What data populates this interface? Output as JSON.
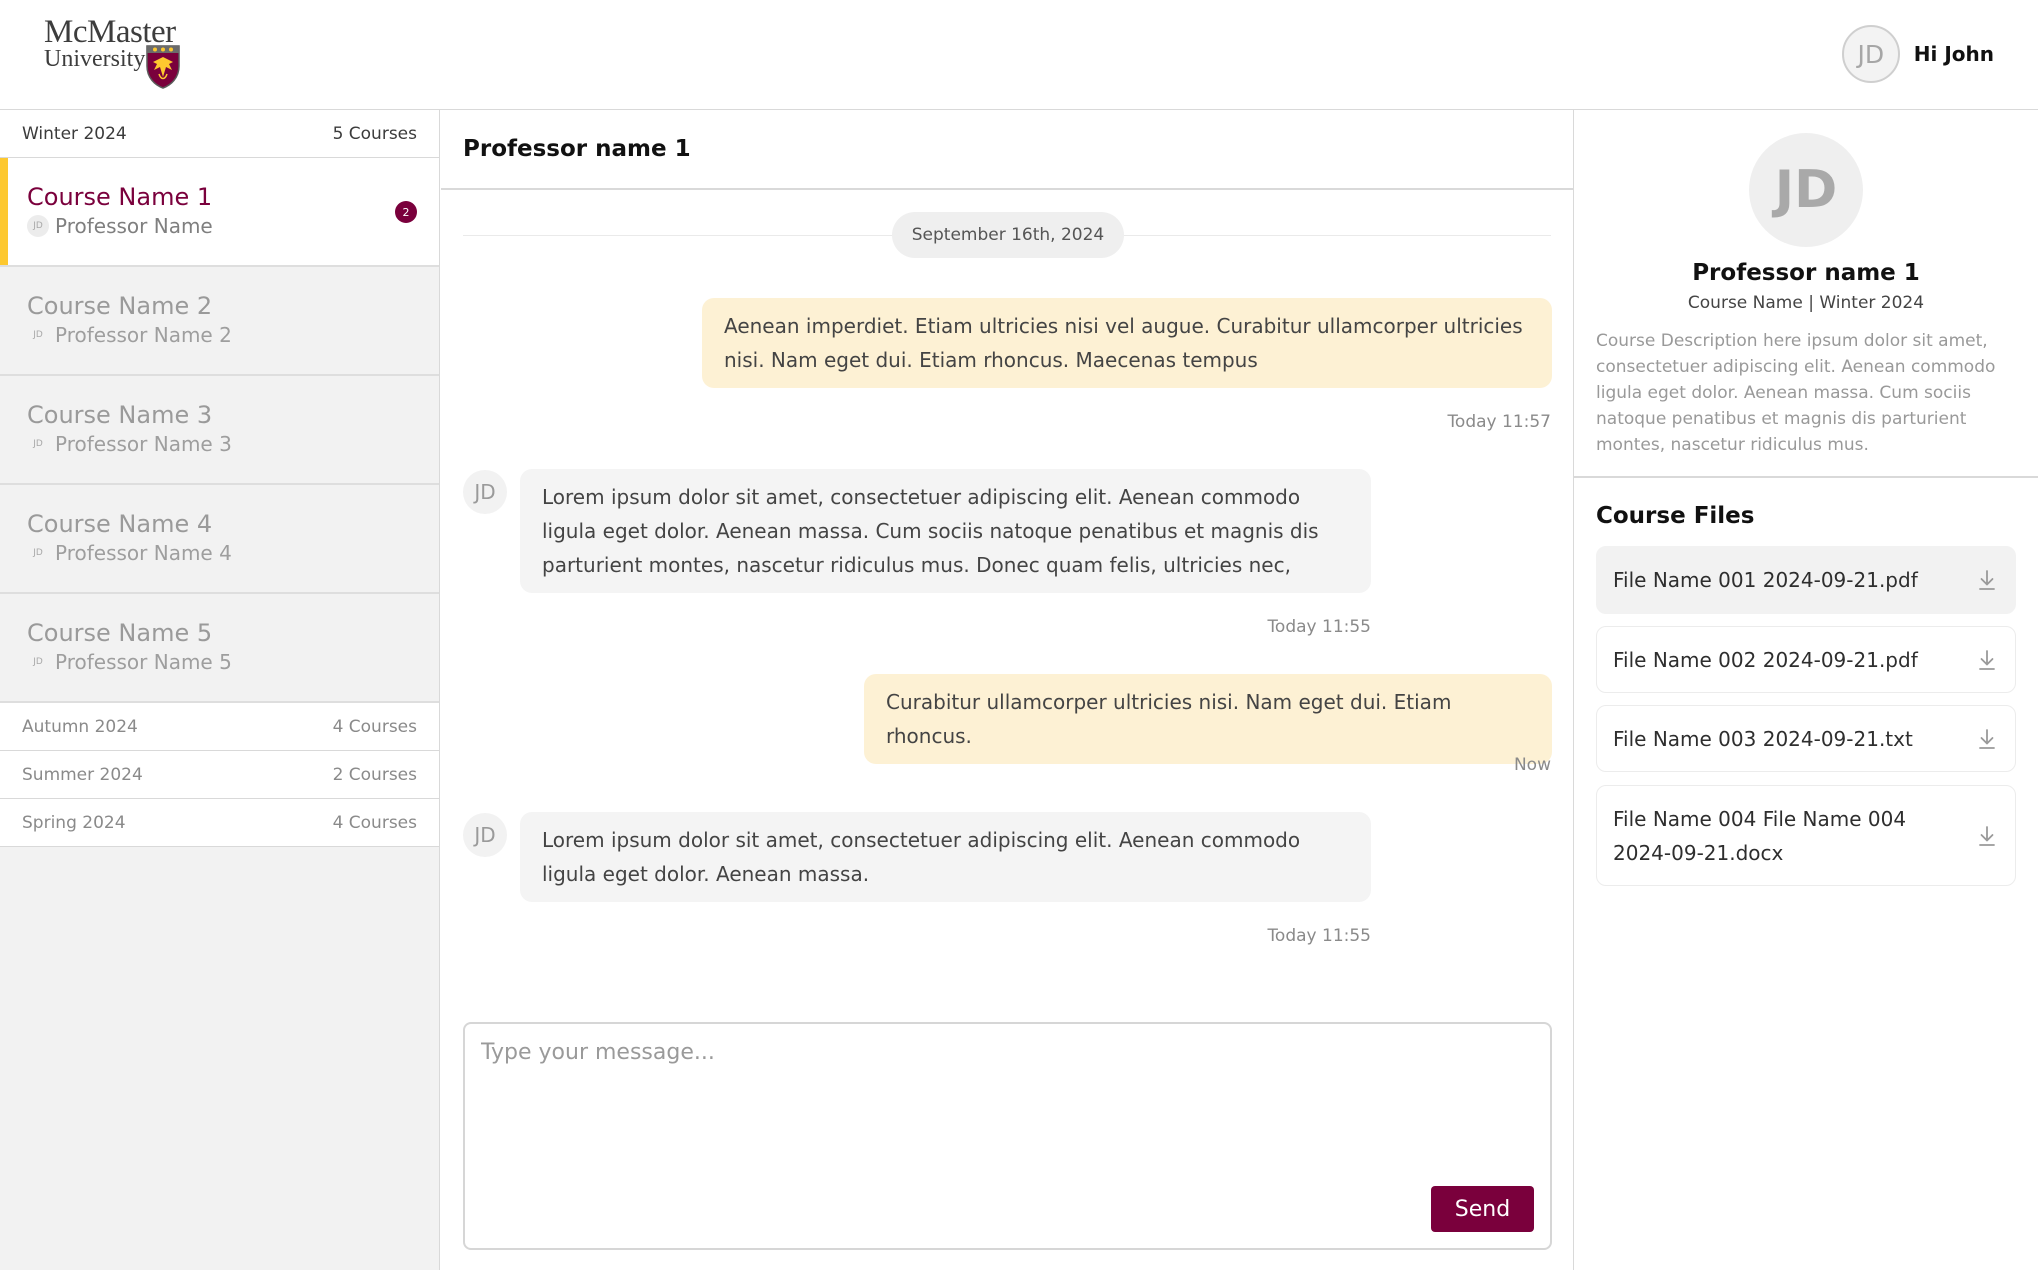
{
  "brand": {
    "line1": "McMaster",
    "line2": "University"
  },
  "user": {
    "initials": "JD",
    "greeting": "Hi John"
  },
  "sidebar": {
    "current_term": {
      "label": "Winter 2024",
      "count": "5 Courses"
    },
    "courses": [
      {
        "name": "Course Name 1",
        "professor": "Professor Name",
        "initials": "JD",
        "unread": "2",
        "active": true
      },
      {
        "name": "Course Name 2",
        "professor": "Professor Name 2",
        "initials": "JD"
      },
      {
        "name": "Course Name 3",
        "professor": "Professor Name 3",
        "initials": "JD"
      },
      {
        "name": "Course Name 4",
        "professor": "Professor Name 4",
        "initials": "JD"
      },
      {
        "name": "Course Name 5",
        "professor": "Professor Name 5",
        "initials": "JD"
      }
    ],
    "other_terms": [
      {
        "label": "Autumn 2024",
        "count": "4 Courses"
      },
      {
        "label": "Summer 2024",
        "count": "2 Courses"
      },
      {
        "label": "Spring 2024",
        "count": "4 Courses"
      }
    ]
  },
  "chat": {
    "title": "Professor name 1",
    "date_separator": "September 16th, 2024",
    "messages": [
      {
        "direction": "out",
        "text": "Aenean imperdiet. Etiam ultricies nisi vel augue. Curabitur ullamcorper ultricies nisi. Nam eget dui. Etiam rhoncus. Maecenas tempus",
        "time": "Today 11:57"
      },
      {
        "direction": "in",
        "sender_initials": "JD",
        "text": "Lorem ipsum dolor sit amet, consectetuer adipiscing elit. Aenean commodo ligula eget dolor. Aenean massa. Cum sociis natoque penatibus et magnis dis parturient montes, nascetur ridiculus mus. Donec quam felis, ultricies nec,",
        "time": "Today 11:55"
      },
      {
        "direction": "out",
        "text": "Curabitur ullamcorper ultricies nisi. Nam eget dui. Etiam rhoncus.",
        "time": "Now"
      },
      {
        "direction": "in",
        "sender_initials": "JD",
        "text": "Lorem ipsum dolor sit amet, consectetuer adipiscing elit. Aenean commodo ligula eget dolor. Aenean massa.",
        "time": "Today 11:55"
      }
    ],
    "composer": {
      "placeholder": "Type your message...",
      "send_label": "Send"
    }
  },
  "details": {
    "initials": "JD",
    "professor": "Professor name 1",
    "course_term": "Course Name | Winter 2024",
    "description": "Course Description here ipsum dolor sit amet, consectetuer adipiscing elit. Aenean commodo ligula eget dolor. Aenean massa. Cum sociis natoque penatibus et magnis dis parturient montes, nascetur ridiculus mus.",
    "files_title": "Course Files",
    "files": [
      {
        "name": "File Name 001 2024-09-21.pdf"
      },
      {
        "name": "File Name 002 2024-09-21.pdf"
      },
      {
        "name": "File Name 003 2024-09-21.txt"
      },
      {
        "name": "File Name 004 File Name 004 2024-09-21.docx"
      }
    ]
  },
  "colors": {
    "brand_maroon": "#7a003c",
    "brand_gold": "#fdc82f",
    "outgoing_bubble": "#fdf1d4",
    "incoming_bubble": "#f4f4f4"
  },
  "icons": [
    "mcmaster-crest-icon",
    "download-icon"
  ]
}
